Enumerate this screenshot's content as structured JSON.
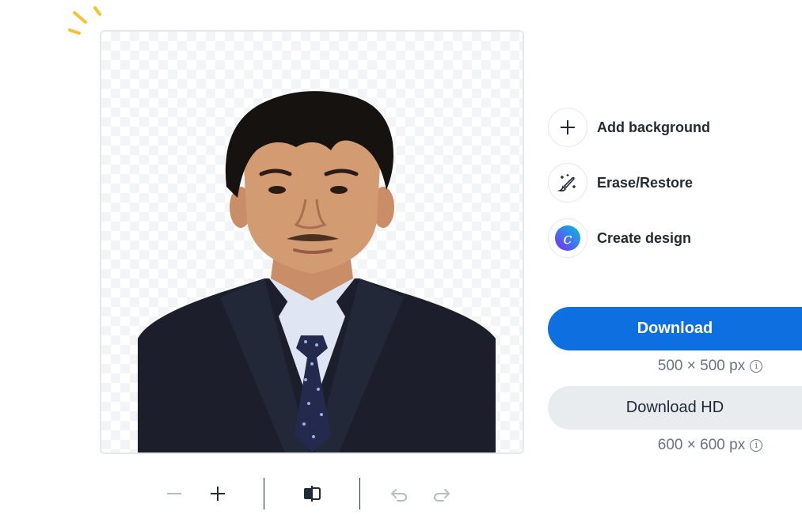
{
  "canvas": {
    "image_alt": "Cut-out portrait of a young man in a dark suit and tie on a transparent background"
  },
  "toolbar": {
    "zoom_out_icon": "minus-icon",
    "zoom_in_icon": "plus-icon",
    "compare_icon": "compare-icon",
    "undo_icon": "undo-icon",
    "redo_icon": "redo-icon"
  },
  "actions": [
    {
      "label": "Add background",
      "icon": "plus-icon"
    },
    {
      "label": "Erase/Restore",
      "icon": "magic-brush-icon"
    },
    {
      "label": "Create design",
      "icon": "canva-logo-icon"
    }
  ],
  "download": {
    "label": "Download",
    "size": "500 × 500 px",
    "info_icon": "i"
  },
  "download_hd": {
    "label": "Download HD",
    "size": "600 × 600 px",
    "info_icon": "i"
  },
  "colors": {
    "primary": "#0d6fe0",
    "secondary_bg": "#e9ecef",
    "accent_sparkle": "#f5c232"
  }
}
